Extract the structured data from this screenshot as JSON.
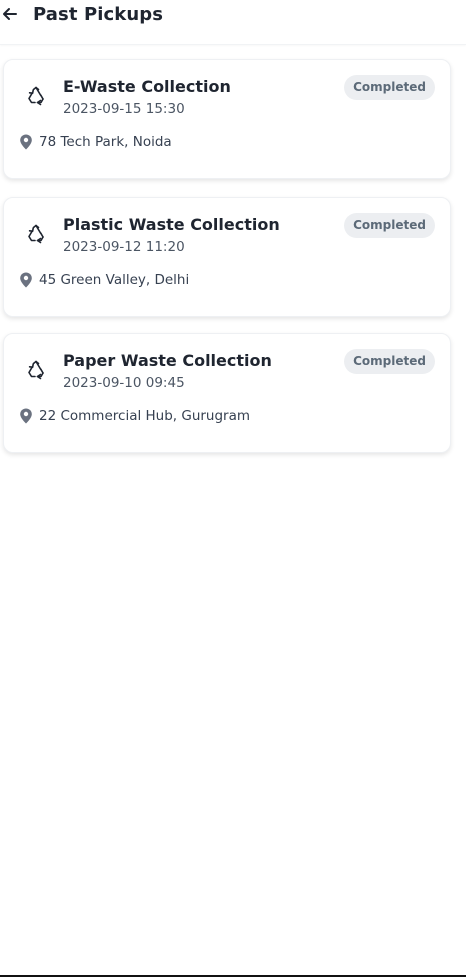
{
  "header": {
    "title": "Past Pickups",
    "back_icon": "arrow-left-icon"
  },
  "pickups": [
    {
      "title": "E-Waste Collection",
      "datetime": "2023-09-15 15:30",
      "location": "78 Tech Park, Noida",
      "status": "Completed",
      "icon": "recycle-icon"
    },
    {
      "title": "Plastic Waste Collection",
      "datetime": "2023-09-12 11:20",
      "location": "45 Green Valley, Delhi",
      "status": "Completed",
      "icon": "recycle-icon"
    },
    {
      "title": "Paper Waste Collection",
      "datetime": "2023-09-10 09:45",
      "location": "22 Commercial Hub, Gurugram",
      "status": "Completed",
      "icon": "recycle-icon"
    }
  ],
  "colors": {
    "text_primary": "#1f2530",
    "text_secondary": "#4b5563",
    "badge_bg": "#eceef1",
    "badge_text": "#5c6a78",
    "pin": "#6b7280"
  }
}
